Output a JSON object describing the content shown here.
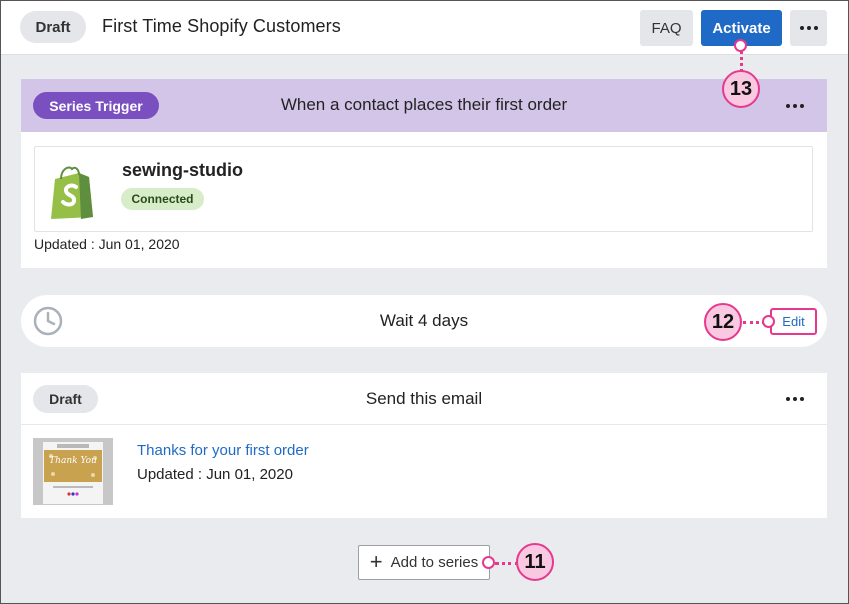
{
  "header": {
    "status_label": "Draft",
    "title": "First Time Shopify Customers",
    "faq_label": "FAQ",
    "activate_label": "Activate"
  },
  "trigger": {
    "badge_label": "Series Trigger",
    "title": "When a contact places their first order",
    "store_name": "sewing-studio",
    "connection_status": "Connected",
    "updated": "Updated : Jun 01, 2020",
    "logo_icon": "shopify-bag-icon"
  },
  "wait_step": {
    "icon": "clock-icon",
    "text": "Wait 4 days",
    "edit_label": "Edit"
  },
  "email_step": {
    "status_label": "Draft",
    "title": "Send this email",
    "email_name": "Thanks for your first order",
    "updated": "Updated : Jun 01, 2020",
    "thumbnail_text": "Thank You"
  },
  "footer": {
    "add_label": "Add to series"
  },
  "callouts": {
    "activate": "13",
    "edit": "12",
    "add": "11"
  },
  "colors": {
    "accent_blue": "#1f6ac6",
    "trigger_purple": "#7a4fc0",
    "trigger_bg": "#d3c5e8",
    "callout_pink": "#e6398e",
    "connected_green": "#d7ecc8"
  }
}
